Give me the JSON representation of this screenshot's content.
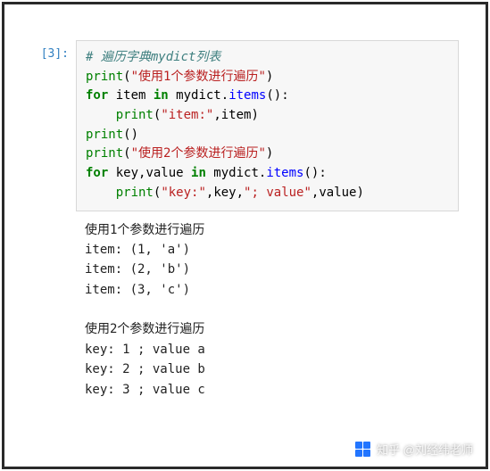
{
  "cell": {
    "prompt": "[3]:",
    "lines": [
      [
        {
          "cls": "c-comment",
          "t": "# 遍历字典mydict列表"
        }
      ],
      [
        {
          "cls": "c-builtin",
          "t": "print"
        },
        {
          "cls": "",
          "t": "("
        },
        {
          "cls": "c-string",
          "t": "\"使用1个参数进行遍历\""
        },
        {
          "cls": "",
          "t": ")"
        }
      ],
      [
        {
          "cls": "c-keyword",
          "t": "for"
        },
        {
          "cls": "",
          "t": " item "
        },
        {
          "cls": "c-keyword",
          "t": "in"
        },
        {
          "cls": "",
          "t": " mydict"
        },
        {
          "cls": "",
          "t": "."
        },
        {
          "cls": "c-func",
          "t": "items"
        },
        {
          "cls": "",
          "t": "():"
        }
      ],
      [
        {
          "cls": "",
          "t": "    "
        },
        {
          "cls": "c-builtin",
          "t": "print"
        },
        {
          "cls": "",
          "t": "("
        },
        {
          "cls": "c-string",
          "t": "\"item:\""
        },
        {
          "cls": "",
          "t": ",item)"
        }
      ],
      [
        {
          "cls": "c-builtin",
          "t": "print"
        },
        {
          "cls": "",
          "t": "()"
        }
      ],
      [
        {
          "cls": "c-builtin",
          "t": "print"
        },
        {
          "cls": "",
          "t": "("
        },
        {
          "cls": "c-string",
          "t": "\"使用2个参数进行遍历\""
        },
        {
          "cls": "",
          "t": ")"
        }
      ],
      [
        {
          "cls": "c-keyword",
          "t": "for"
        },
        {
          "cls": "",
          "t": " key,value "
        },
        {
          "cls": "c-keyword",
          "t": "in"
        },
        {
          "cls": "",
          "t": " mydict"
        },
        {
          "cls": "",
          "t": "."
        },
        {
          "cls": "c-func",
          "t": "items"
        },
        {
          "cls": "",
          "t": "():"
        }
      ],
      [
        {
          "cls": "",
          "t": "    "
        },
        {
          "cls": "c-builtin",
          "t": "print"
        },
        {
          "cls": "",
          "t": "("
        },
        {
          "cls": "c-string",
          "t": "\"key:\""
        },
        {
          "cls": "",
          "t": ",key,"
        },
        {
          "cls": "c-string",
          "t": "\"; value\""
        },
        {
          "cls": "",
          "t": ",value)"
        }
      ]
    ],
    "output": "使用1个参数进行遍历\nitem: (1, 'a')\nitem: (2, 'b')\nitem: (3, 'c')\n\n使用2个参数进行遍历\nkey: 1 ; value a\nkey: 2 ; value b\nkey: 3 ; value c"
  },
  "watermark": {
    "text": "知乎 @刘经纬老师"
  }
}
